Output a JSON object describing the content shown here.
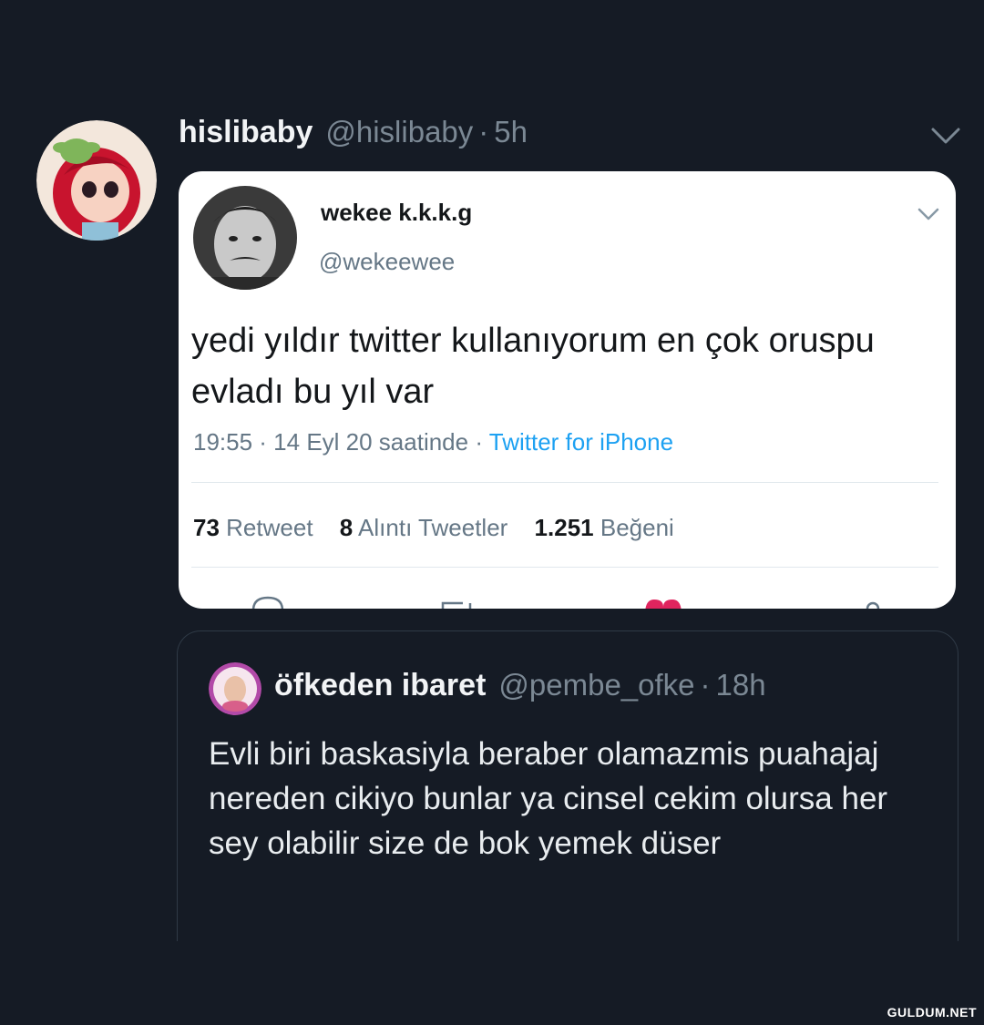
{
  "tweet": {
    "name": "hislibaby",
    "handle": "@hislibaby",
    "separator": "·",
    "time": "5h"
  },
  "embedded": {
    "name": "wekee k.k.k.g",
    "handle": "@wekeewee",
    "text": "yedi yıldır twitter kullanıyorum en çok oruspu evladı bu yıl var",
    "timestamp": "19:55 · 14 Eyl 20 saatinde",
    "meta_separator": " · ",
    "source": "Twitter for iPhone",
    "stats": {
      "retweets_count": "73",
      "retweets_label": "Retweet",
      "quotes_count": "8",
      "quotes_label": "Alıntı Tweetler",
      "likes_count": "1.251",
      "likes_label": "Beğeni"
    },
    "colors": {
      "link": "#1da1f2",
      "like": "#e0245e"
    }
  },
  "quote": {
    "name": "öfkeden ibaret",
    "handle": "@pembe_ofke",
    "separator": "·",
    "time": "18h",
    "text": "Evli biri baskasiyla beraber olamazmis puahajaj nereden cikiyo bunlar ya cinsel cekim olursa her sey olabilir size de bok yemek düser"
  },
  "watermark": "GULDUM.NET",
  "icons": [
    "chevron-down-icon",
    "reply-icon",
    "retweet-icon",
    "like-icon",
    "share-icon"
  ]
}
